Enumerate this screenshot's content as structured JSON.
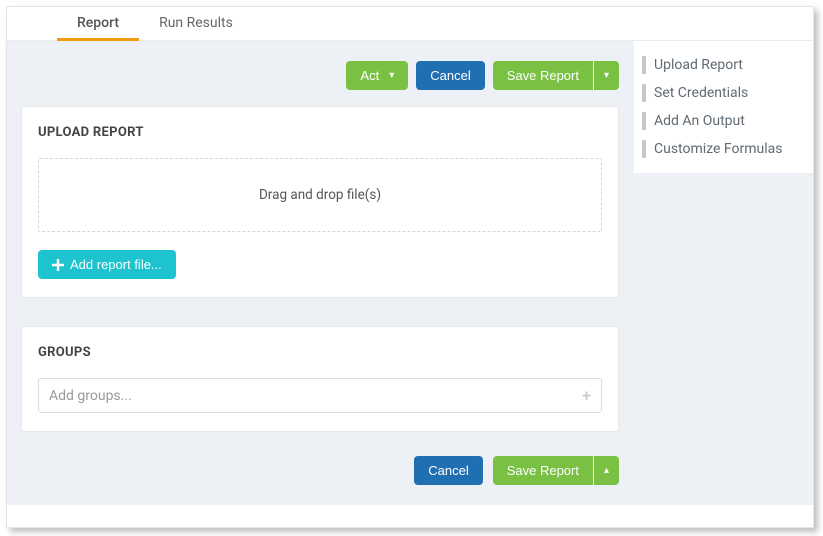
{
  "tabs": {
    "report": "Report",
    "run_results": "Run Results"
  },
  "toolbar": {
    "act": "Act",
    "cancel": "Cancel",
    "save_report": "Save Report"
  },
  "upload_card": {
    "title": "UPLOAD REPORT",
    "dropzone_text": "Drag and drop file(s)",
    "add_file_label": "Add report file..."
  },
  "groups_card": {
    "title": "GROUPS",
    "placeholder": "Add groups..."
  },
  "bottom": {
    "cancel": "Cancel",
    "save_report": "Save Report"
  },
  "sidebar": {
    "items": [
      "Upload Report",
      "Set Credentials",
      "Add An Output",
      "Customize Formulas"
    ]
  }
}
